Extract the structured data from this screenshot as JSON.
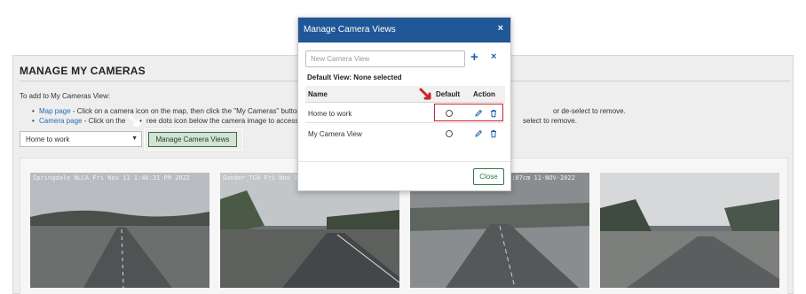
{
  "page": {
    "title": "MANAGE MY CAMERAS",
    "intro": "To add to My Cameras View:",
    "bullet1_link": "Map page",
    "bullet1_text": " - Click on a camera icon on the map, then click the \"My Cameras\" button a",
    "bullet1_tail": "or de-select to remove.",
    "bullet2_link": "Camera page",
    "bullet2_text": " - Click on the",
    "bullet2_mid": "ree dots icon below the camera image to access th",
    "bullet2_tail": "select to remove.",
    "view_select_value": "Home to work",
    "manage_button_label": "Manage Camera Views"
  },
  "cameras": [
    {
      "stamp": "Springdale NLCA  Fri Nov 11   1:46:31 PM  2022"
    },
    {
      "stamp": "Gander_TCH Fri Nov 11 12:38 NL"
    },
    {
      "stamp": "9:07cm 11-NOV-2022"
    },
    {
      "stamp": ""
    }
  ],
  "modal": {
    "title": "Manage Camera Views",
    "close_symbol": "×",
    "new_view_placeholder": "New Camera View",
    "add_symbol": "+",
    "clear_symbol": "×",
    "default_view_text": "Default View: None selected",
    "columns": {
      "name": "Name",
      "default": "Default",
      "action": "Action"
    },
    "rows": [
      {
        "name": "Home to work",
        "default_selected": false
      },
      {
        "name": "My Camera View",
        "default_selected": false
      }
    ],
    "close_label": "Close"
  },
  "colors": {
    "header_blue": "#1f5797",
    "icon_blue": "#1f5fa8",
    "close_green": "#2f7a4c",
    "highlight_red": "#c9242a"
  }
}
